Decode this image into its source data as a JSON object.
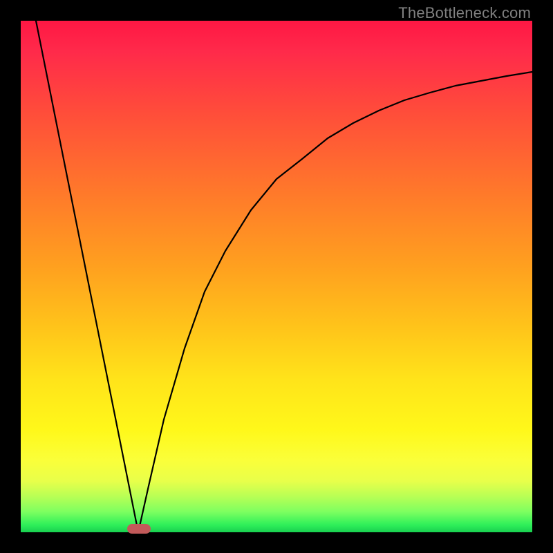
{
  "watermark": "TheBottleneck.com",
  "colors": {
    "frame": "#000000",
    "gradient_top": "#ff1744",
    "gradient_mid_orange": "#ffa01f",
    "gradient_mid_yellow": "#fff81a",
    "gradient_bottom": "#18d050",
    "curve": "#000000",
    "marker": "#c25a5a",
    "watermark": "#808080"
  },
  "chart_data": {
    "type": "line",
    "title": "",
    "xlabel": "",
    "ylabel": "",
    "xlim": [
      0,
      100
    ],
    "ylim": [
      0,
      100
    ],
    "note": "Single V-shaped curve. Left branch linear from (x≈3, y=100) down to minimum. Right branch rises asymptotically toward y≈90 by x=100. Minimum at x≈23, y≈0.",
    "series": [
      {
        "name": "bottleneck-curve",
        "x": [
          3,
          6,
          9,
          12,
          15,
          18,
          21,
          23,
          25,
          28,
          32,
          36,
          40,
          45,
          50,
          55,
          60,
          65,
          70,
          75,
          80,
          85,
          90,
          95,
          100
        ],
        "y": [
          100,
          85,
          70,
          55,
          40,
          25,
          10,
          0,
          9,
          22,
          36,
          47,
          55,
          63,
          69,
          73,
          77,
          80,
          82.5,
          84.5,
          86,
          87.3,
          88.3,
          89.2,
          90
        ]
      }
    ],
    "marker": {
      "x": 23,
      "y": 0,
      "shape": "rounded-bar"
    }
  }
}
